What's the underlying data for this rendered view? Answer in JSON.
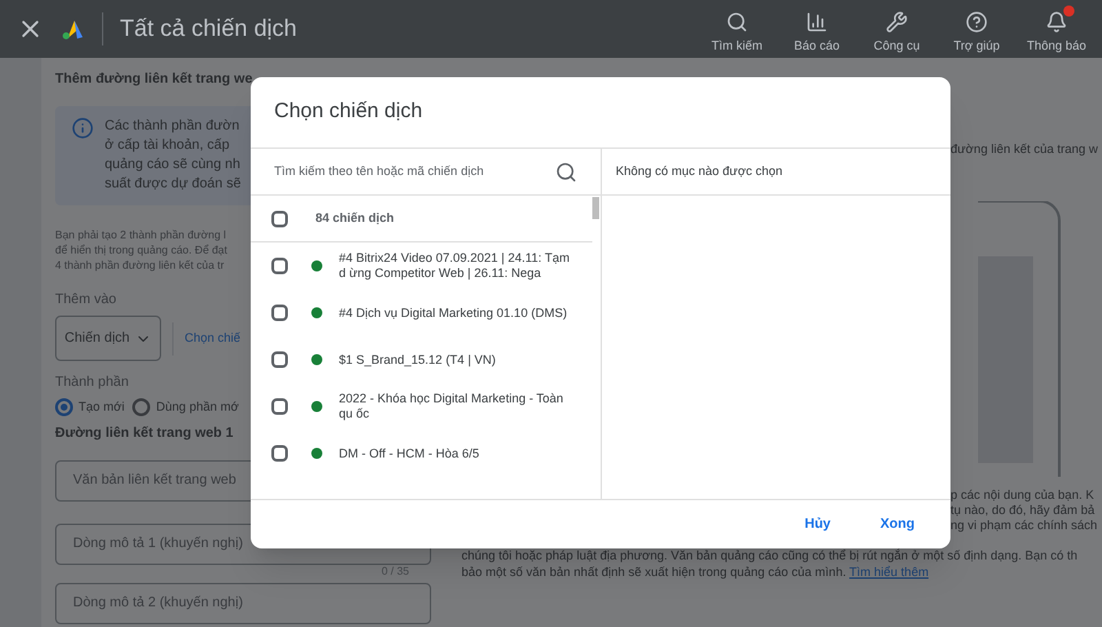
{
  "header": {
    "title": "Tất cả chiến dịch",
    "actions": [
      {
        "kind": "search",
        "label": "Tìm kiếm"
      },
      {
        "kind": "report",
        "label": "Báo cáo"
      },
      {
        "kind": "tools",
        "label": "Công cụ"
      },
      {
        "kind": "help",
        "label": "Trợ giúp"
      },
      {
        "kind": "bell",
        "label": "Thông báo",
        "badge": true
      }
    ]
  },
  "background": {
    "section_title": "Thêm đường liên kết trang we",
    "info_lines": [
      "Các thành phần đườn",
      "ở cấp tài khoản, cấp",
      "quảng cáo sẽ cùng nh",
      "suất được dự đoán sẽ"
    ],
    "note_lines": [
      "Bạn phải tạo 2 thành phần đường l",
      "để hiển thị trong quảng cáo. Để đạt",
      "4 thành phần đường liên kết của tr"
    ],
    "add_to_label": "Thêm vào",
    "add_to_value": "Chiến dịch",
    "choose_link": "Chọn chiế",
    "component_label": "Thành phần",
    "radios": [
      {
        "label": "Tạo mới",
        "selected": true
      },
      {
        "label": "Dùng phần mớ",
        "selected": false
      }
    ],
    "link_title": "Đường liên kết trang web 1",
    "fields": [
      {
        "placeholder": "Văn bản liên kết trang web"
      },
      {
        "placeholder": "Dòng mô tả 1 (khuyến nghị)",
        "counter": "0 / 35"
      },
      {
        "placeholder": "Dòng mô tả 2 (khuyến nghị)"
      }
    ],
    "right_heading": "đường liên kết của trang w",
    "right_fragments": [
      "p các nội dung của bạn. K",
      "tụ nào, do đó, hãy đảm bả",
      "ng vi phạm các chính sách"
    ],
    "bottom_lines": [
      "chúng tôi hoặc pháp luật địa phương. Văn bản quảng cáo cũng có thể bị rút ngắn ở một số định dạng. Bạn có th",
      "bảo một số văn bản nhất định sẽ xuất hiện trong quảng cáo của mình."
    ],
    "learn_more": "Tìm hiểu thêm"
  },
  "dialog": {
    "title": "Chọn chiến dịch",
    "search_placeholder": "Tìm kiếm theo tên hoặc mã chiến dịch",
    "select_all": {
      "label": "84 chiến dịch",
      "checked": false
    },
    "campaigns": [
      {
        "name": "#4 Bitrix24 Video 07.09.2021 | 24.11: Tạm d ừng Competitor Web | 26.11: Nega",
        "checked": false,
        "color": "#188038"
      },
      {
        "name": "#4 Dịch vụ Digital Marketing 01.10 (DMS)",
        "checked": false,
        "color": "#188038"
      },
      {
        "name": "$1 S_Brand_15.12 (T4 | VN)",
        "checked": false,
        "color": "#188038"
      },
      {
        "name": "2022 - Khóa học Digital Marketing - Toàn qu ốc",
        "checked": false,
        "color": "#188038"
      },
      {
        "name": "DM - Off - HCM - Hòa 6/5",
        "checked": false,
        "color": "#188038"
      }
    ],
    "empty_text": "Không có mục nào được chọn",
    "buttons": [
      "Hủy",
      "Xong"
    ]
  }
}
